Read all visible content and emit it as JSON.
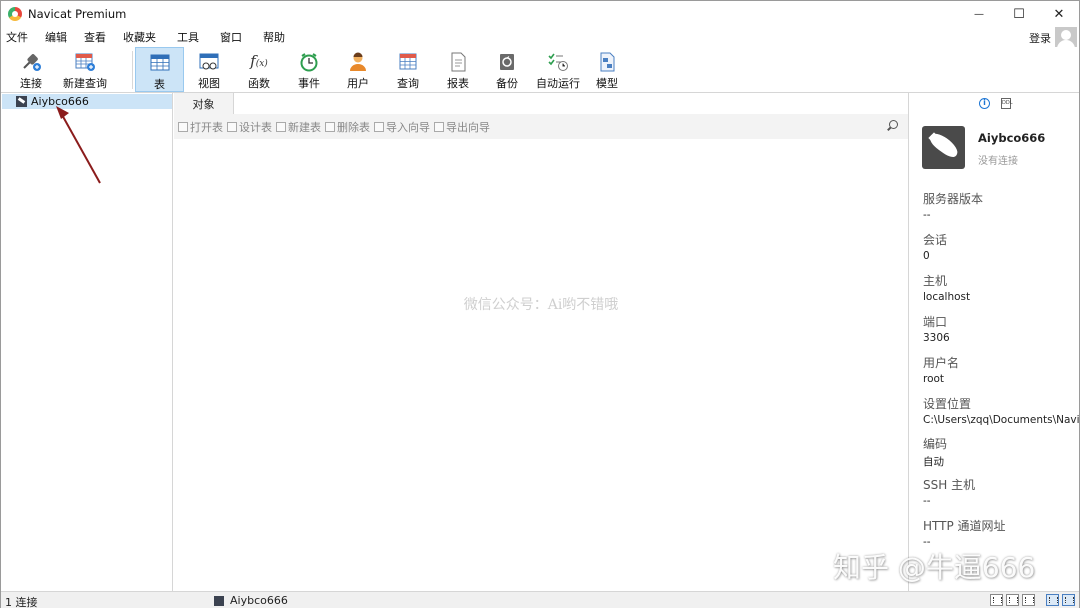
{
  "window": {
    "title": "Navicat Premium",
    "minimize_glyph": "—",
    "maximize_glyph": "☐",
    "close_glyph": "✕"
  },
  "menu": [
    "文件",
    "编辑",
    "查看",
    "收藏夹",
    "工具",
    "窗口",
    "帮助"
  ],
  "account": {
    "login_label": "登录",
    "icon": "user-avatar-icon"
  },
  "toolbar": {
    "items": [
      {
        "label": "连接",
        "icon": "plug-connection-icon"
      },
      {
        "label": "新建查询",
        "icon": "new-query-icon"
      },
      {
        "label": "表",
        "icon": "table-icon",
        "active": true
      },
      {
        "label": "视图",
        "icon": "view-icon"
      },
      {
        "label": "函数",
        "icon": "function-icon"
      },
      {
        "label": "事件",
        "icon": "clock-event-icon"
      },
      {
        "label": "用户",
        "icon": "user-icon"
      },
      {
        "label": "查询",
        "icon": "query-icon"
      },
      {
        "label": "报表",
        "icon": "report-icon"
      },
      {
        "label": "备份",
        "icon": "backup-icon"
      },
      {
        "label": "自动运行",
        "icon": "automation-icon"
      },
      {
        "label": "模型",
        "icon": "model-icon"
      }
    ]
  },
  "navigator": {
    "connections": [
      {
        "name": "Aiybco666",
        "selected": true
      }
    ]
  },
  "object_tab": {
    "label": "对象"
  },
  "object_toolbar": [
    "打开表",
    "设计表",
    "新建表",
    "删除表",
    "导入向导",
    "导出向导"
  ],
  "watermark": "微信公众号：Ai哟不错哦",
  "info_panel": {
    "connection_name": "Aiybco666",
    "connection_status": "没有连接",
    "properties": [
      {
        "key": "服务器版本",
        "value": "--"
      },
      {
        "key": "会话",
        "value": "0"
      },
      {
        "key": "主机",
        "value": "localhost"
      },
      {
        "key": "端口",
        "value": "3306"
      },
      {
        "key": "用户名",
        "value": "root"
      },
      {
        "key": "设置位置",
        "value": "C:\\Users\\zqq\\Documents\\Navic"
      },
      {
        "key": "编码",
        "value": "自动"
      },
      {
        "key": "SSH 主机",
        "value": "--"
      },
      {
        "key": "HTTP 通道网址",
        "value": "--"
      }
    ]
  },
  "statusbar": {
    "left": "1 连接",
    "connection": "Aiybco666"
  },
  "overlay_watermark": "知乎 @牛逼666",
  "colors": {
    "selection": "#cce4f7",
    "annotation_arrow": "#8b1c1c"
  }
}
